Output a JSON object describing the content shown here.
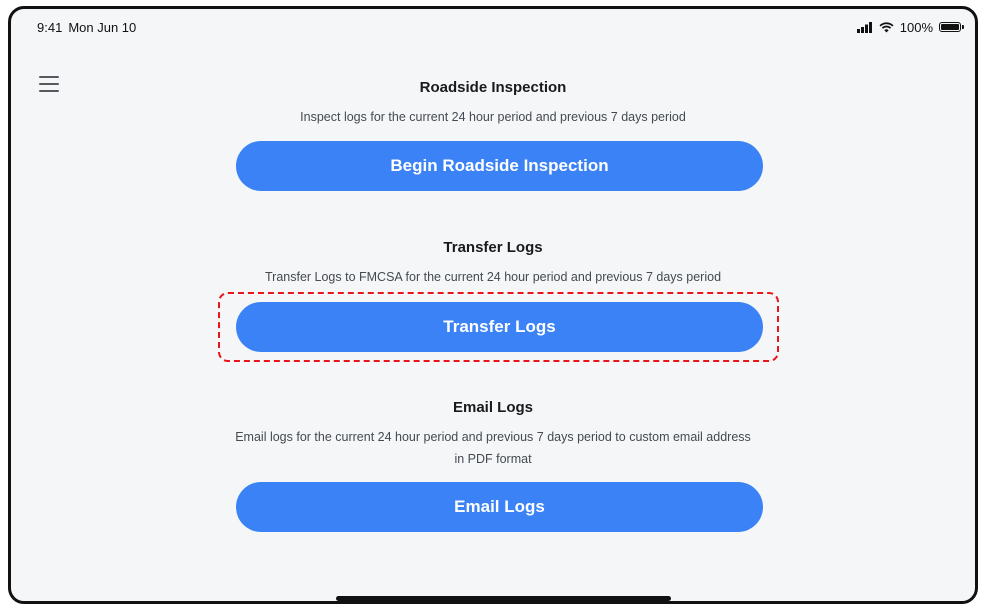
{
  "status_bar": {
    "time": "9:41",
    "date": "Mon Jun 10",
    "signal_icon": "cellular-signal-icon",
    "wifi_icon": "wifi-icon",
    "battery_percent": "100%",
    "battery_icon": "battery-icon"
  },
  "nav": {
    "menu_icon": "hamburger-menu-icon"
  },
  "sections": {
    "roadside": {
      "title": "Roadside Inspection",
      "description": "Inspect logs for the current 24 hour period and previous 7 days period",
      "button_label": "Begin Roadside Inspection"
    },
    "transfer": {
      "title": "Transfer Logs",
      "description": "Transfer Logs to FMCSA for the current 24 hour period and previous 7 days period",
      "button_label": "Transfer Logs"
    },
    "email": {
      "title": "Email Logs",
      "description": "Email logs for the current 24 hour period and previous 7 days period to custom email address in PDF format",
      "button_label": "Email Logs"
    }
  },
  "colors": {
    "button_blue": "#3b82f6",
    "highlight_red": "#e8161b",
    "background": "#f5f6f7"
  }
}
